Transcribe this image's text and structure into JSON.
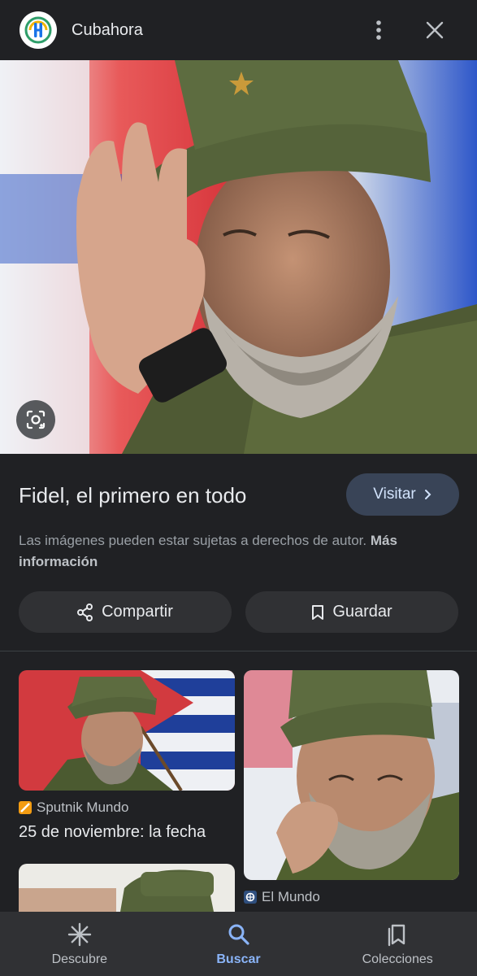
{
  "header": {
    "site_name": "Cubahora",
    "logo_icon": "cubahora-logo",
    "more_icon": "more-vert-icon",
    "close_icon": "close-icon"
  },
  "main_image": {
    "lens_icon": "lens-icon"
  },
  "info": {
    "title": "Fidel, el primero en todo",
    "visit_label": "Visitar",
    "rights_text": "Las imágenes pueden estar sujetas a derechos de autor.",
    "more_info_label": "Más información",
    "share_label": "Compartir",
    "save_label": "Guardar"
  },
  "related": [
    {
      "source": "Sputnik Mundo",
      "title": "25 de noviembre: la fecha"
    },
    {
      "source": "El Mundo",
      "title": ""
    },
    {
      "source": "",
      "title": ""
    }
  ],
  "bottom_nav": [
    {
      "label": "Descubre",
      "icon": "asterisk-icon",
      "active": false
    },
    {
      "label": "Buscar",
      "icon": "search-icon",
      "active": true
    },
    {
      "label": "Colecciones",
      "icon": "collections-icon",
      "active": false
    }
  ],
  "colors": {
    "background": "#202124",
    "surface": "#303134",
    "accent": "#8ab4f8",
    "visit_button": "#394457"
  }
}
